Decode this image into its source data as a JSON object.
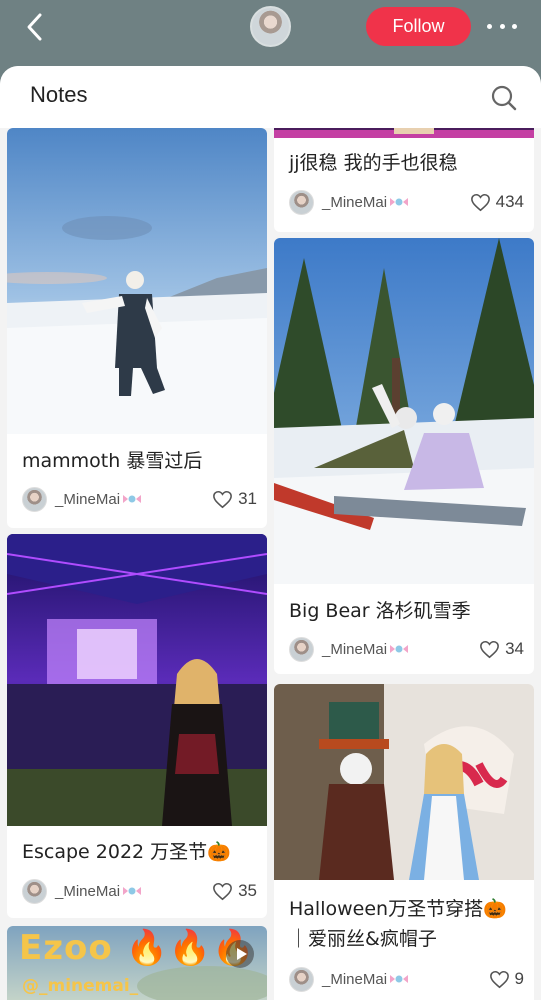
{
  "header": {
    "follow_label": "Follow"
  },
  "section": {
    "title": "Notes"
  },
  "cards": {
    "mammoth": {
      "title": "mammoth 暴雪过后",
      "author": "_MineMai",
      "likes": "31"
    },
    "jj": {
      "title": "jj很稳 我的手也很稳",
      "author": "_MineMai",
      "likes": "434"
    },
    "bigbear": {
      "title": "Big Bear 洛杉矶雪季",
      "author": "_MineMai",
      "likes": "34"
    },
    "escape": {
      "title": "Escape 2022 万圣节🎃",
      "author": "_MineMai",
      "likes": "35"
    },
    "halloween": {
      "title_line1": "Halloween万圣节穿搭🎃",
      "title_line2": "｜爱丽丝&疯帽子",
      "author": "_MineMai",
      "likes": "9"
    },
    "ezoo": {
      "overlay_title": "Ezoo 🔥🔥🔥",
      "overlay_handle": "@_minemai_"
    }
  },
  "colors": {
    "follow_bg": "#f0334a",
    "topbar_bg": "#6f8183"
  },
  "icons": [
    "back-icon",
    "more-icon",
    "search-icon",
    "heart-icon",
    "candy-icon",
    "play-icon"
  ]
}
